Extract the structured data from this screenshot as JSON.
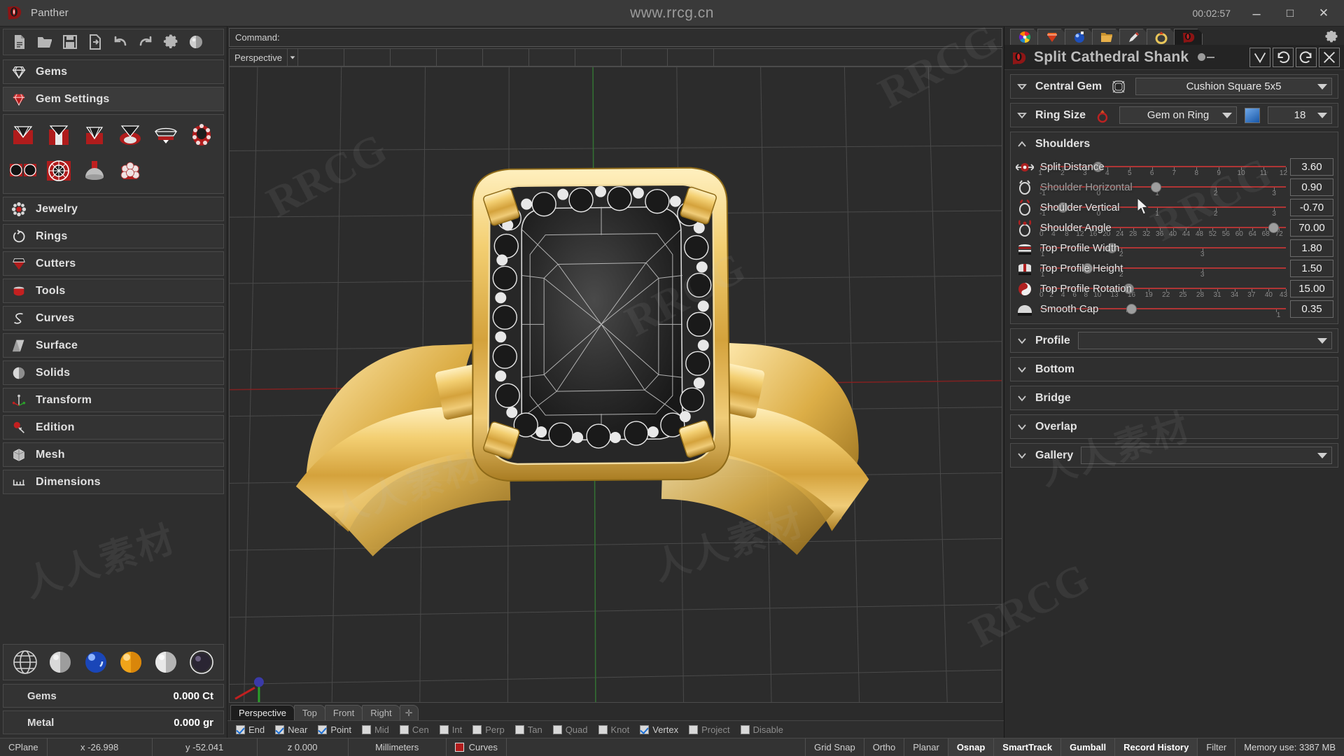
{
  "window": {
    "app_title": "Panther",
    "center_text": "www.rrcg.cn",
    "timer": "00:02:57",
    "minimize": "–",
    "maximize": "□",
    "close": "✕"
  },
  "sidebar": {
    "toolbar": [
      "new-file-icon",
      "open-folder-icon",
      "save-icon",
      "save-as-icon",
      "undo-icon",
      "redo-icon",
      "gear-icon",
      "render-sphere-icon"
    ],
    "sections": [
      {
        "label": "Gems",
        "icon": "diamond-outline-icon"
      },
      {
        "label": "Gem Settings",
        "icon": "diamond-red-icon",
        "active": true
      }
    ],
    "gem_icons_row1": [
      "gem-setting-basket",
      "gem-setting-prong",
      "gem-setting-bezel",
      "gem-setting-halo",
      "gem-setting-marquise",
      "gem-setting-cluster"
    ],
    "gem_icons_row2": [
      "gem-pave-pair",
      "gem-pave-round",
      "gem-cutter-cone",
      "gem-cluster-dome"
    ],
    "items": [
      {
        "label": "Jewelry",
        "icon": "jewelry-flower-icon"
      },
      {
        "label": "Rings",
        "icon": "ring-icon"
      },
      {
        "label": "Cutters",
        "icon": "cutter-gem-icon"
      },
      {
        "label": "Tools",
        "icon": "tools-bucket-icon"
      },
      {
        "label": "Curves",
        "icon": "curves-s-icon"
      },
      {
        "label": "Surface",
        "icon": "surface-plane-icon"
      },
      {
        "label": "Solids",
        "icon": "solids-sphere-icon"
      },
      {
        "label": "Transform",
        "icon": "transform-axis-icon"
      },
      {
        "label": "Edition",
        "icon": "edition-icon"
      },
      {
        "label": "Mesh",
        "icon": "mesh-cube-icon"
      },
      {
        "label": "Dimensions",
        "icon": "dimensions-icon"
      }
    ],
    "material_swatches": [
      "globe-icon",
      "silver-sphere",
      "blue-sphere",
      "gold-sphere",
      "white-sphere",
      "dark-sphere-selected"
    ],
    "stats": [
      {
        "key": "Gems",
        "value": "0.000 Ct"
      },
      {
        "key": "Metal",
        "value": "0.000 gr"
      }
    ]
  },
  "center": {
    "command_label": "Command:",
    "viewport_mode": "Perspective",
    "viewport_tabs": [
      {
        "label": "Perspective",
        "active": true
      },
      {
        "label": "Top",
        "active": false
      },
      {
        "label": "Front",
        "active": false
      },
      {
        "label": "Right",
        "active": false
      },
      {
        "label": "✛",
        "active": false
      }
    ],
    "snaps": [
      {
        "label": "End",
        "checked": true
      },
      {
        "label": "Near",
        "checked": true
      },
      {
        "label": "Point",
        "checked": true
      },
      {
        "label": "Mid",
        "checked": false
      },
      {
        "label": "Cen",
        "checked": false
      },
      {
        "label": "Int",
        "checked": false
      },
      {
        "label": "Perp",
        "checked": false
      },
      {
        "label": "Tan",
        "checked": false
      },
      {
        "label": "Quad",
        "checked": false
      },
      {
        "label": "Knot",
        "checked": false
      },
      {
        "label": "Vertex",
        "checked": true
      },
      {
        "label": "Project",
        "checked": false
      },
      {
        "label": "Disable",
        "checked": false
      }
    ],
    "status": {
      "cplane": "CPlane",
      "x": "x -26.998",
      "y": "y -52.041",
      "z": "z 0.000",
      "units": "Millimeters",
      "layer": "Curves",
      "layer_color": "#b11c1c",
      "toggles": [
        {
          "label": "Grid Snap",
          "on": false
        },
        {
          "label": "Ortho",
          "on": false
        },
        {
          "label": "Planar",
          "on": false
        },
        {
          "label": "Osnap",
          "on": true
        },
        {
          "label": "SmartTrack",
          "on": true
        },
        {
          "label": "Gumball",
          "on": true
        },
        {
          "label": "Record History",
          "on": true
        },
        {
          "label": "Filter",
          "on": false
        }
      ],
      "memory": "Memory use: 3387 MB"
    }
  },
  "right_panel": {
    "tabs": [
      {
        "icon": "color-wheel-icon",
        "active": false
      },
      {
        "icon": "red-gem-icon",
        "active": false
      },
      {
        "icon": "blue-sphere-icon",
        "active": false
      },
      {
        "icon": "folder-icon",
        "active": false
      },
      {
        "icon": "pencil-icon",
        "active": false
      },
      {
        "icon": "gold-ring-icon",
        "active": false
      },
      {
        "icon": "panther-icon",
        "active": true
      }
    ],
    "gear": "gear-icon",
    "title": "Split Cathedral Shank",
    "header_buttons": [
      "check-icon",
      "undo-icon",
      "redo-icon",
      "close-icon"
    ],
    "groups": [
      {
        "name": "Central Gem",
        "expanded": false,
        "icon": "cushion-gem-icon",
        "value": "Cushion Square 5x5",
        "type": "combo"
      },
      {
        "name": "Ring Size",
        "expanded": false,
        "icon": "ring-gem-icon",
        "value": "Gem on Ring",
        "swatch": "#3a7fd0",
        "size": "18",
        "type": "combo-dual"
      },
      {
        "name": "Shoulders",
        "expanded": true,
        "type": "sliders",
        "sliders": [
          {
            "label": "Split Distance",
            "value": "3.60",
            "icon": "split-distance-icon",
            "min": 1,
            "max": 12,
            "pos": 0.215,
            "ticks": [
              1,
              2,
              3,
              4,
              5,
              6,
              7,
              8,
              9,
              10,
              11,
              12
            ],
            "dim": false
          },
          {
            "label": "Shoulder Horizontal",
            "value": "0.90",
            "icon": "shoulder-horizontal-icon",
            "min": -1,
            "max": 3.2,
            "pos": 0.45,
            "ticks": [
              -1,
              0,
              1,
              2,
              3
            ],
            "dim": true
          },
          {
            "label": "Shoulder Vertical",
            "value": "-0.70",
            "icon": "shoulder-vertical-icon",
            "min": -1,
            "max": 3.2,
            "pos": 0.07,
            "ticks": [
              -1,
              0,
              1,
              2,
              3
            ],
            "dim": false
          },
          {
            "label": "Shoulder Angle",
            "value": "70.00",
            "icon": "shoulder-angle-icon",
            "min": 0,
            "max": 74,
            "pos": 0.93,
            "ticks": [
              0,
              4,
              8,
              12,
              16,
              20,
              24,
              28,
              32,
              36,
              40,
              44,
              48,
              52,
              56,
              60,
              64,
              68,
              72
            ],
            "dim": false
          },
          {
            "label": "Top Profile Width",
            "value": "1.80",
            "icon": "top-profile-width-icon",
            "min": 1,
            "max": 4,
            "pos": 0.27,
            "ticks": [
              1,
              2,
              3
            ],
            "dim": false
          },
          {
            "label": "Top Profile Height",
            "value": "1.50",
            "icon": "top-profile-height-icon",
            "min": 1,
            "max": 4,
            "pos": 0.17,
            "ticks": [
              1,
              2,
              3
            ],
            "dim": false
          },
          {
            "label": "Top Profile Rotation",
            "value": "15.00",
            "icon": "top-profile-rotation-icon",
            "min": 0,
            "max": 45,
            "pos": 0.34,
            "ticks": [
              0,
              2,
              4,
              6,
              8,
              10,
              13,
              16,
              19,
              22,
              25,
              28,
              31,
              34,
              37,
              40,
              43
            ],
            "dim": false
          },
          {
            "label": "Smooth Cap",
            "value": "0.35",
            "icon": "smooth-cap-icon",
            "min": 0,
            "max": 1,
            "pos": 0.35,
            "ticks": [
              0,
              1
            ],
            "dim": false
          }
        ]
      },
      {
        "name": "Profile",
        "expanded": false,
        "type": "combo-empty"
      },
      {
        "name": "Bottom",
        "expanded": false,
        "type": "plain"
      },
      {
        "name": "Bridge",
        "expanded": false,
        "type": "plain"
      },
      {
        "name": "Overlap",
        "expanded": false,
        "type": "plain"
      },
      {
        "name": "Gallery",
        "expanded": false,
        "type": "combo-empty"
      }
    ]
  },
  "watermarks": [
    "RRCG",
    "人人素材"
  ]
}
